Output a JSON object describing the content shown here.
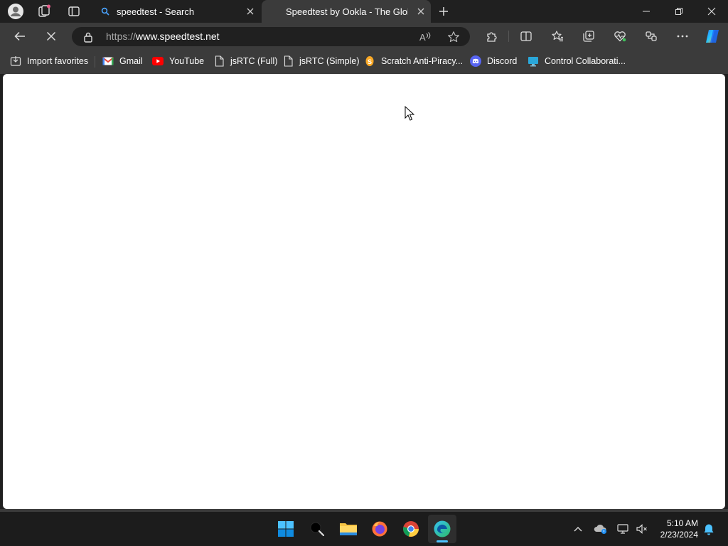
{
  "browser": {
    "tabs": [
      {
        "title": "speedtest - Search",
        "active": false
      },
      {
        "title": "Speedtest by Ookla - The Global",
        "active": true
      }
    ],
    "address": {
      "protocol": "https://",
      "host": "www.speedtest.net"
    },
    "favorites": [
      {
        "label": "Import favorites",
        "icon": "import-icon"
      },
      {
        "label": "Gmail",
        "icon": "gmail-icon"
      },
      {
        "label": "YouTube",
        "icon": "youtube-icon"
      },
      {
        "label": "jsRTC (Full)",
        "icon": "page-icon"
      },
      {
        "label": "jsRTC (Simple)",
        "icon": "page-icon"
      },
      {
        "label": "Scratch Anti-Piracy...",
        "icon": "scratch-icon"
      },
      {
        "label": "Discord",
        "icon": "discord-icon"
      },
      {
        "label": "Control Collaborati...",
        "icon": "monitor-icon"
      }
    ]
  },
  "taskbar": {
    "apps": [
      "start-icon",
      "search-icon",
      "file-explorer-icon",
      "firefox-icon",
      "chrome-icon",
      "edge-icon"
    ],
    "clock": {
      "time": "5:10 AM",
      "date": "2/23/2024"
    }
  },
  "colors": {
    "accent": "#0078d4",
    "chrome_dark": "#202020",
    "chrome_light": "#3b3b3b"
  }
}
